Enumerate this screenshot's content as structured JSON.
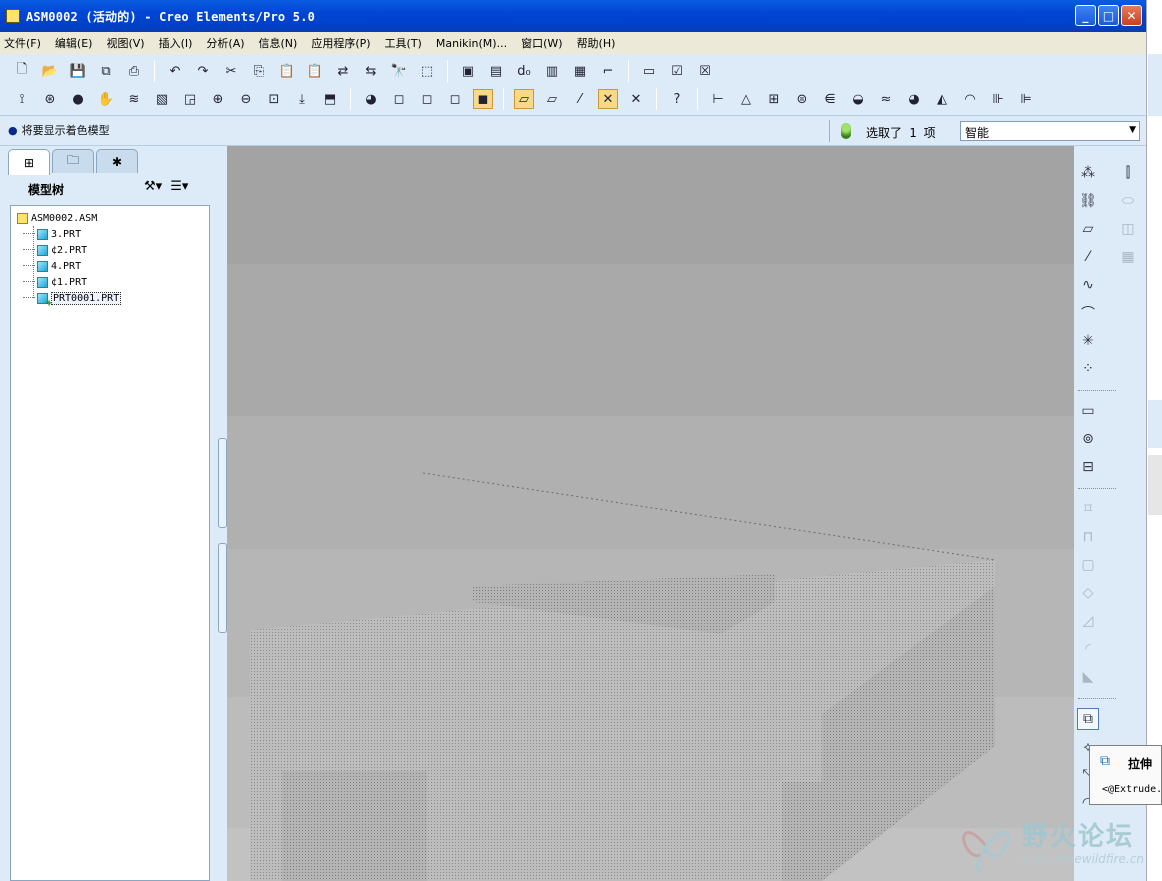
{
  "window": {
    "title": "ASM0002 (活动的) - Creo Elements/Pro 5.0",
    "controls": [
      "minimize",
      "maximize",
      "close"
    ]
  },
  "menubar": {
    "items": [
      "文件(F)",
      "编辑(E)",
      "视图(V)",
      "插入(I)",
      "分析(A)",
      "信息(N)",
      "应用程序(P)",
      "工具(T)",
      "Manikin(M)...",
      "窗口(W)",
      "帮助(H)"
    ]
  },
  "toolbar": {
    "row1_icons": [
      "new-icon",
      "open-icon",
      "save-icon",
      "copy-icon",
      "print-icon",
      "undo-icon",
      "redo-icon",
      "cut-icon",
      "copy-icon",
      "paste-icon",
      "paste-special-icon",
      "regenerate-icon",
      "regen-manager-icon",
      "find-icon",
      "select-box-icon",
      "layer-icon",
      "datum-icon",
      "relations-icon",
      "window-icon",
      "activate-icon",
      "close-window-icon"
    ],
    "row2_icons": [
      "datum-display-icon",
      "spin-center-icon",
      "shading-icon",
      "pan-icon",
      "layers-icon",
      "view-manager-icon",
      "zoom-in-icon",
      "zoom-out-icon",
      "refit-icon",
      "reorient-icon",
      "saved-views-icon",
      "color-icon",
      "wireframe-icon",
      "hidden-line-icon",
      "no-hidden-icon",
      "shaded-icon",
      "datum-planes-icon",
      "datum-axes-icon",
      "datum-points-icon",
      "coord-sys-icon",
      "help-icon",
      "measure-icon",
      "analysis-icon",
      "section-icon",
      "curvature-icon",
      "draft-icon",
      "surface-icon",
      "reflection-icon"
    ]
  },
  "status": {
    "message": "将要显示着色模型",
    "selected_count": "选取了 1 项",
    "filter_value": "智能"
  },
  "model_tree": {
    "tabs": [
      "model-tree-tab",
      "folder-tab",
      "favorites-tab"
    ],
    "title": "模型树",
    "items": [
      {
        "label": "ASM0002.ASM",
        "type": "assembly"
      },
      {
        "label": "3.PRT",
        "type": "part"
      },
      {
        "label": "¢2.PRT",
        "type": "part"
      },
      {
        "label": "4.PRT",
        "type": "part"
      },
      {
        "label": "¢1.PRT",
        "type": "part"
      },
      {
        "label": "PRT0001.PRT",
        "type": "part",
        "selected": true
      }
    ]
  },
  "right_toolbar": {
    "icons": [
      "datum-point-icon",
      "datum-axis-chain-icon",
      "datum-plane-icon",
      "datum-axis-icon",
      "datum-curve-icon",
      "sketch-curve-icon",
      "coord-sys-icon",
      "analysis-feature-icon",
      "sketch-icon",
      "offset-icon",
      "feature-ops-icon",
      "extrude-icon",
      "revolve-icon",
      "sweep-icon",
      "hole-icon",
      "shell-icon",
      "rib-icon",
      "draft-icon",
      "round-icon",
      "chamfer-icon",
      "extrude-assembly-icon"
    ]
  },
  "tooltip": {
    "title": "拉伸",
    "description": "<@Extrude."
  },
  "watermark": {
    "title": "野火论坛",
    "url": "www.proewildfire.cn"
  },
  "colors": {
    "titlebar": "#0046d5",
    "panel": "#dcebf7",
    "viewport": "#a8a8a8",
    "selection": "#f6d98a"
  }
}
